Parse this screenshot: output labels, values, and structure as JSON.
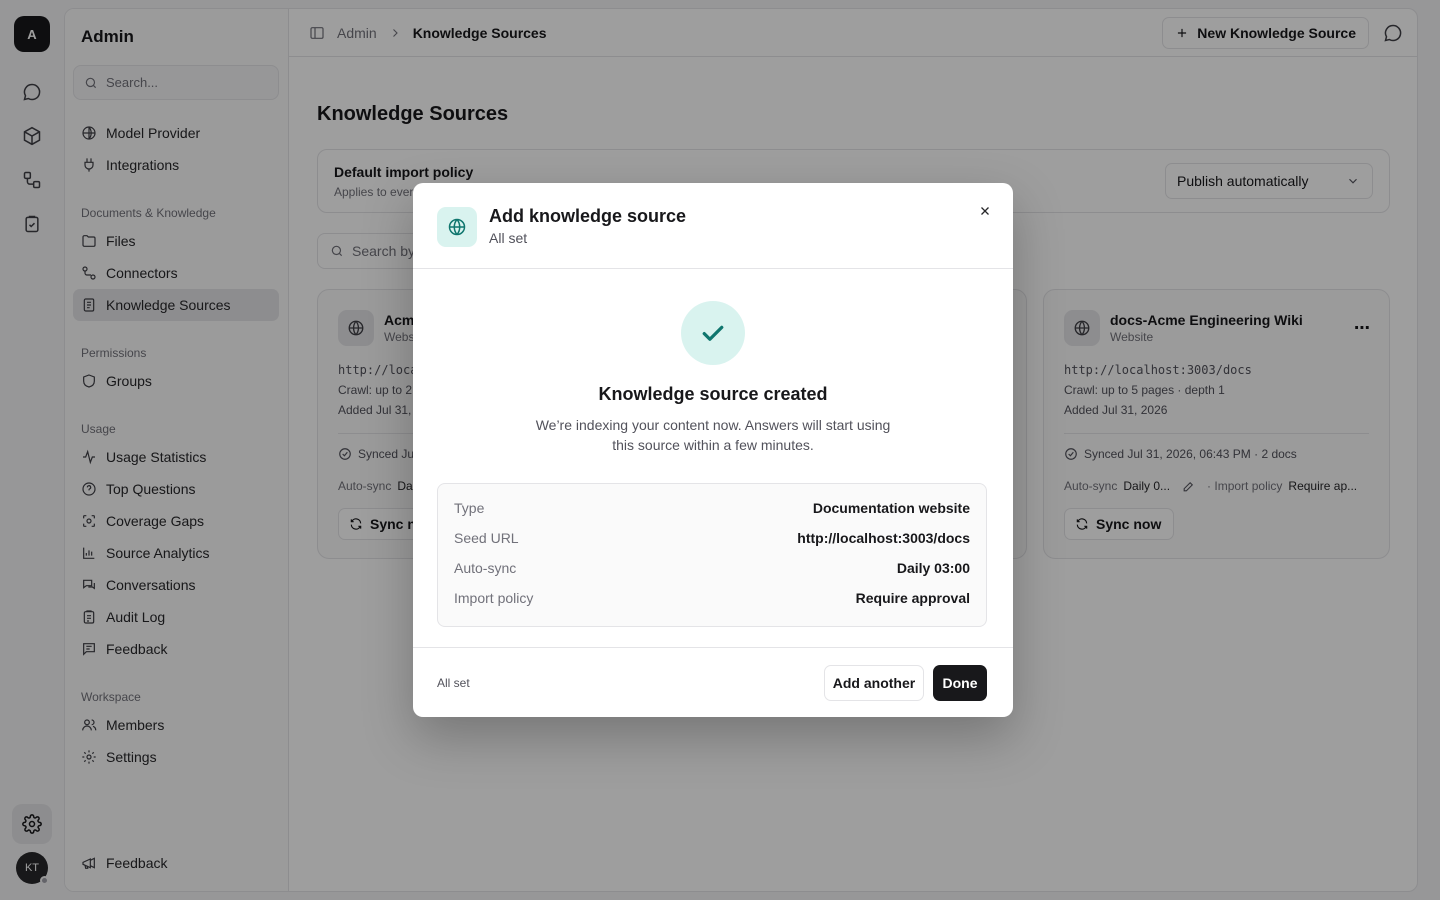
{
  "rail": {
    "logo": "A",
    "avatar": "KT"
  },
  "sidebar": {
    "title": "Admin",
    "search_placeholder": "Search...",
    "top_items": [
      {
        "label": "Model Provider"
      },
      {
        "label": "Integrations"
      }
    ],
    "sections": [
      {
        "label": "Documents & Knowledge",
        "items": [
          {
            "label": "Files"
          },
          {
            "label": "Connectors"
          },
          {
            "label": "Knowledge Sources",
            "active": true
          }
        ]
      },
      {
        "label": "Permissions",
        "items": [
          {
            "label": "Groups"
          }
        ]
      },
      {
        "label": "Usage",
        "items": [
          {
            "label": "Usage Statistics"
          },
          {
            "label": "Top Questions"
          },
          {
            "label": "Coverage Gaps"
          },
          {
            "label": "Source Analytics"
          },
          {
            "label": "Conversations"
          },
          {
            "label": "Audit Log"
          },
          {
            "label": "Feedback"
          }
        ]
      },
      {
        "label": "Workspace",
        "items": [
          {
            "label": "Members"
          },
          {
            "label": "Settings"
          }
        ]
      }
    ],
    "footer_feedback": "Feedback"
  },
  "topbar": {
    "breadcrumb_root": "Admin",
    "breadcrumb_current": "Knowledge Sources",
    "new_button": "New Knowledge Source"
  },
  "main": {
    "title": "Knowledge Sources",
    "policy": {
      "title": "Default import policy",
      "subtitle": "Applies to ever",
      "selected": "Publish automatically"
    },
    "search_placeholder": "Search by",
    "cards": [
      {
        "name": "Acm",
        "type": "Webs",
        "url": "http://loca",
        "crawl": "Crawl: up to 2",
        "added": "Added Jul 31,",
        "synced": "Synced Ju",
        "autosync_label": "Auto-sync",
        "autosync_value": "Da",
        "sync_button": "Sync no"
      },
      {
        "name": "docs-Acme Engineering Wiki",
        "type": "Website",
        "url": "http://localhost:3003/docs",
        "crawl": "Crawl: up to 5 pages · depth 1",
        "added": "Added Jul 31, 2026",
        "synced": "Synced Jul 31, 2026, 06:43 PM · 2 docs",
        "autosync_label": "Auto-sync",
        "autosync_value": "Daily 0...",
        "policy_label": "· Import policy",
        "policy_value": "Require ap...",
        "sync_button": "Sync now"
      }
    ]
  },
  "modal": {
    "title": "Add knowledge source",
    "subtitle": "All set",
    "heading": "Knowledge source created",
    "description": "We’re indexing your content now. Answers will start using this source within a few minutes.",
    "summary": [
      {
        "key": "Type",
        "value": "Documentation website"
      },
      {
        "key": "Seed URL",
        "value": "http://localhost:3003/docs"
      },
      {
        "key": "Auto-sync",
        "value": "Daily 03:00"
      },
      {
        "key": "Import policy",
        "value": "Require approval"
      }
    ],
    "footer_status": "All set",
    "add_another": "Add another",
    "done": "Done"
  },
  "colors": {
    "accent_teal": "#0f766e",
    "accent_teal_bg": "#d9f3ef",
    "primary": "#18181b"
  }
}
